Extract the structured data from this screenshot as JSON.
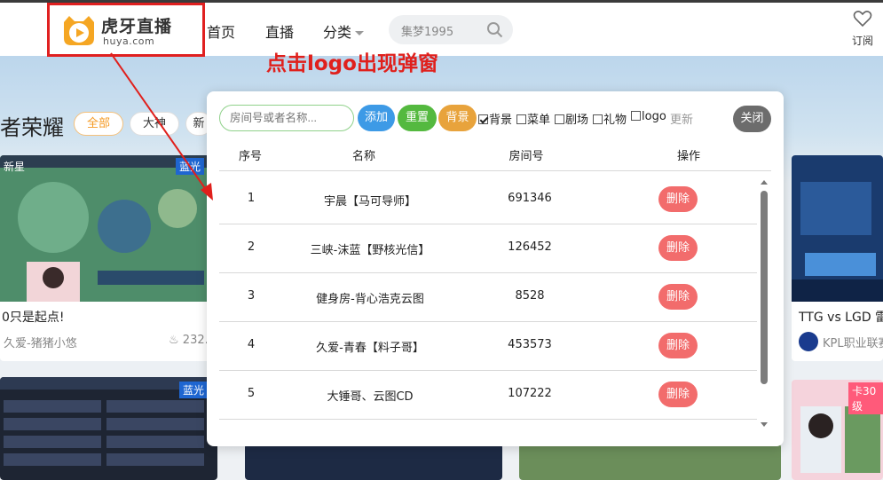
{
  "header": {
    "logo_cn": "虎牙直播",
    "logo_en": "huya.com",
    "nav": [
      "首页",
      "直播",
      "分类"
    ],
    "search_value": "集梦1995",
    "subscribe_label": "订阅"
  },
  "annotation": {
    "text": "点击logo出现弹窗",
    "color": "#e0201c"
  },
  "background": {
    "section_title": "者荣耀",
    "filters": [
      "全部",
      "大神",
      "新"
    ],
    "cards": [
      {
        "top_label": "新星",
        "badge": "蓝光",
        "title": "0只是起点!",
        "author": "久爱-猪猪小悠",
        "heat": "232."
      },
      {
        "title": "TTG vs LGD 雷",
        "author": "KPL职业联赛"
      },
      {
        "badge": "蓝光"
      },
      {
        "badge": "卡30级"
      }
    ]
  },
  "modal": {
    "search_placeholder": "房间号或者名称...",
    "buttons": {
      "add": "添加",
      "reset": "重置",
      "background": "背景",
      "close": "关闭"
    },
    "checkboxes": [
      {
        "label": "背景",
        "checked": true
      },
      {
        "label": "菜单",
        "checked": false
      },
      {
        "label": "剧场",
        "checked": false
      },
      {
        "label": "礼物",
        "checked": false
      },
      {
        "label": "logo",
        "checked": false
      }
    ],
    "refresh_label": "更新",
    "columns": [
      "序号",
      "名称",
      "房间号",
      "操作"
    ],
    "delete_label": "删除",
    "rows": [
      {
        "index": "1",
        "name": "宇晨【马可导师】",
        "room": "691346"
      },
      {
        "index": "2",
        "name": "三峡-沫蓝【野核光信】",
        "room": "126452"
      },
      {
        "index": "3",
        "name": "健身房-背心浩克云图",
        "room": "8528"
      },
      {
        "index": "4",
        "name": "久爱-青春【料子哥】",
        "room": "453573"
      },
      {
        "index": "5",
        "name": "大锤哥、云图CD",
        "room": "107222"
      }
    ]
  },
  "colors": {
    "add": "#3d9ae6",
    "reset": "#54b93f",
    "background": "#e8a33c",
    "close": "#6c6c6c",
    "delete": "#f26c6c",
    "accent": "#f59a23"
  }
}
